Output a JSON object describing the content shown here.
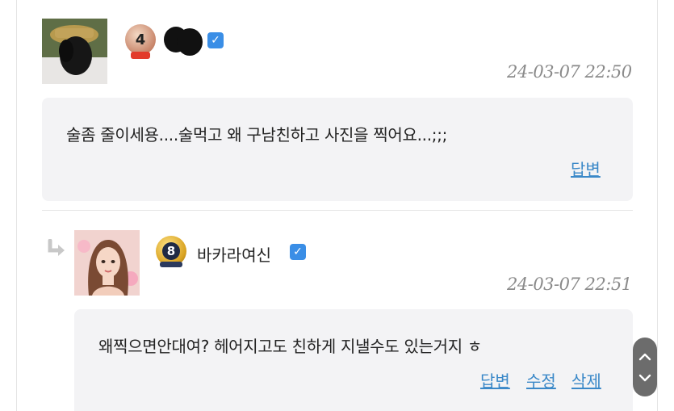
{
  "comments": [
    {
      "author": {
        "level": "4",
        "nickname_hidden": true,
        "verified": true
      },
      "timestamp": "24-03-07 22:50",
      "text": "술좀 줄이세용....술먹고 왜 구남친하고 사진을 찍어요...;;;",
      "actions": {
        "reply": "답변"
      }
    }
  ],
  "replies": [
    {
      "author": {
        "level": "8",
        "nickname": "바카라여신",
        "verified": true
      },
      "timestamp": "24-03-07 22:51",
      "text": "왜찍으면안대여? 헤어지고도 친하게 지낼수도 있는거지 ㅎ",
      "actions": {
        "reply": "답변",
        "edit": "수정",
        "delete": "삭제"
      }
    }
  ],
  "colors": {
    "bubble_bg": "#f3f3f5",
    "link": "#3a88c8",
    "timestamp": "#8a8a8a",
    "verified": "#3a8ee6",
    "scroll_widget": "#6c6c6c"
  },
  "icons": {
    "verified": "check-badge-icon",
    "reply_arrow": "reply-arrow-icon",
    "scroll_up": "chevron-up-icon",
    "scroll_down": "chevron-down-icon"
  }
}
